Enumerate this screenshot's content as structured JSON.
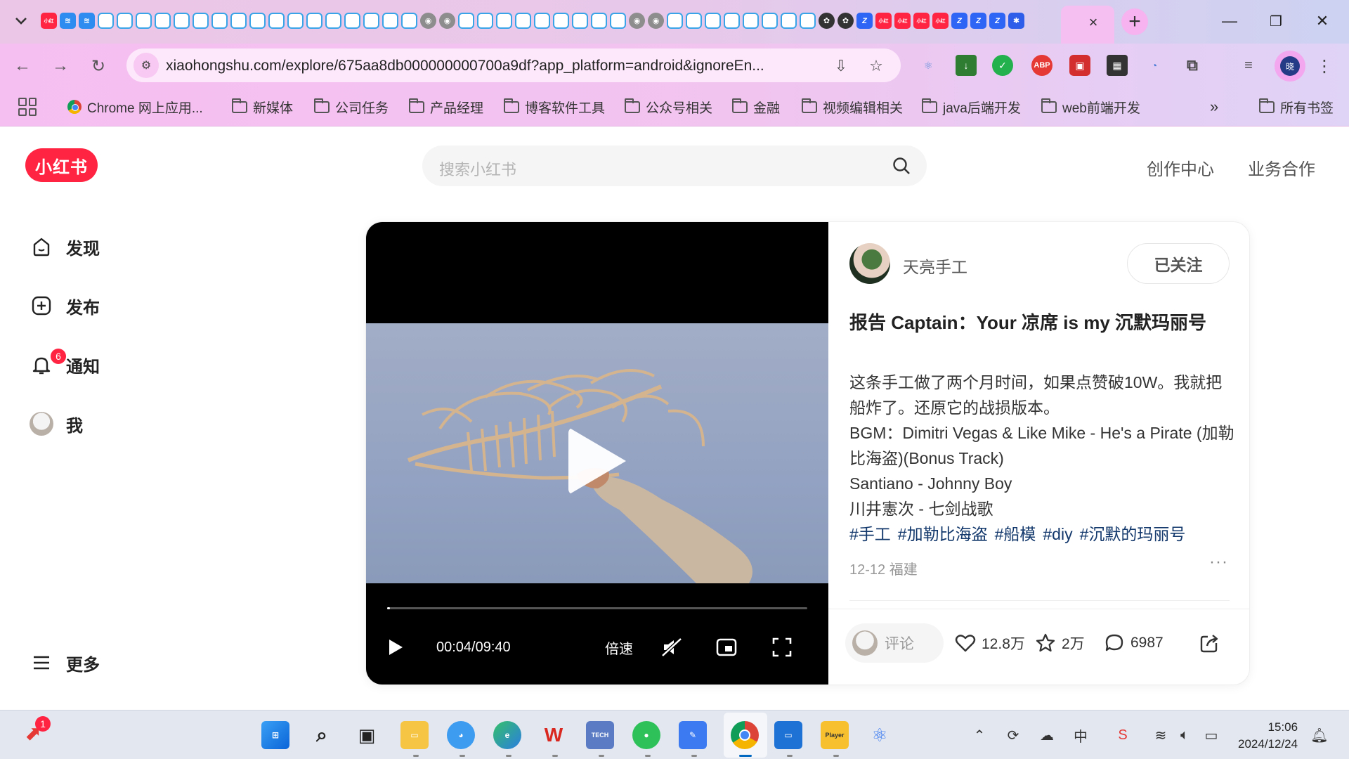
{
  "browser": {
    "tab_close": "×",
    "new_tab": "+",
    "win_min": "—",
    "win_max": "❐",
    "win_close": "✕",
    "tab_icons": [
      "xhs",
      "blue",
      "blue",
      "tv",
      "tv",
      "tv",
      "tv",
      "tv",
      "tv",
      "tv",
      "tv",
      "tv",
      "tv",
      "tv",
      "tv",
      "tv",
      "tv",
      "tv",
      "tv",
      "tv",
      "gray",
      "gray",
      "tv",
      "tv",
      "tv",
      "tv",
      "tv",
      "tv",
      "tv",
      "tv",
      "tv",
      "gray",
      "gray",
      "tv",
      "tv",
      "tv",
      "tv",
      "tv",
      "tv",
      "tv",
      "tv",
      "dark",
      "dark",
      "z",
      "xhs",
      "xhs",
      "xhs",
      "xhs",
      "z",
      "z",
      "z",
      "paw"
    ],
    "url": "xiaohongshu.com/explore/675aa8db000000000700a9df?app_platform=android&ignoreEn...",
    "profile_initial": "晓"
  },
  "bookmarks": {
    "items": [
      {
        "label": "Chrome 网上应用...",
        "type": "chrome"
      },
      {
        "label": "新媒体",
        "type": "folder"
      },
      {
        "label": "公司任务",
        "type": "folder"
      },
      {
        "label": "产品经理",
        "type": "folder"
      },
      {
        "label": "博客软件工具",
        "type": "folder"
      },
      {
        "label": "公众号相关",
        "type": "folder"
      },
      {
        "label": "金融",
        "type": "folder"
      },
      {
        "label": "视频编辑相关",
        "type": "folder"
      },
      {
        "label": "java后端开发",
        "type": "folder"
      },
      {
        "label": "web前端开发",
        "type": "folder"
      }
    ],
    "overflow": "»",
    "all_bookmarks": "所有书签"
  },
  "xhs": {
    "logo": "小红书",
    "search_placeholder": "搜索小红书",
    "top_links": [
      "创作中心",
      "业务合作"
    ],
    "sidebar": [
      {
        "label": "发现",
        "icon": "discover-icon"
      },
      {
        "label": "发布",
        "icon": "publish-icon"
      },
      {
        "label": "通知",
        "icon": "bell-icon",
        "badge": "6"
      },
      {
        "label": "我",
        "icon": "avatar"
      }
    ],
    "more": "更多",
    "note": {
      "author": "天亮手工",
      "follow": "已关注",
      "title": "报告 Captain：Your 凉席 is my 沉默玛丽号",
      "desc_lines": [
        "这条手工做了两个月时间，如果点赞破10W。我就把船炸了。还原它的战损版本。",
        "BGM：Dimitri Vegas & Like Mike - He's a Pirate (加勒比海盗)(Bonus Track)",
        "Santiano - Johnny Boy",
        "川井憲次 - 七剑战歌"
      ],
      "tags": [
        "#手工",
        "#加勒比海盗",
        "#船模",
        "#diy",
        "#沉默的玛丽号"
      ],
      "date": "12-12 福建",
      "more": "···",
      "comment_placeholder": "评论",
      "likes": "12.8万",
      "collects": "2万",
      "comments": "6987"
    },
    "video": {
      "time": "00:04/09:40",
      "speed": "倍速",
      "progress": 0.007
    }
  },
  "taskbar": {
    "notify_badge": "1",
    "apps": [
      "start",
      "search",
      "taskview",
      "files",
      "qq",
      "edge",
      "wps",
      "tech",
      "wechat",
      "feishu",
      "chrome",
      "window",
      "player",
      "network"
    ],
    "tray_ime": "中",
    "time": "15:06",
    "date": "2024/12/24"
  },
  "colors": {
    "brand": "#ff2442",
    "tag": "#13386c"
  }
}
